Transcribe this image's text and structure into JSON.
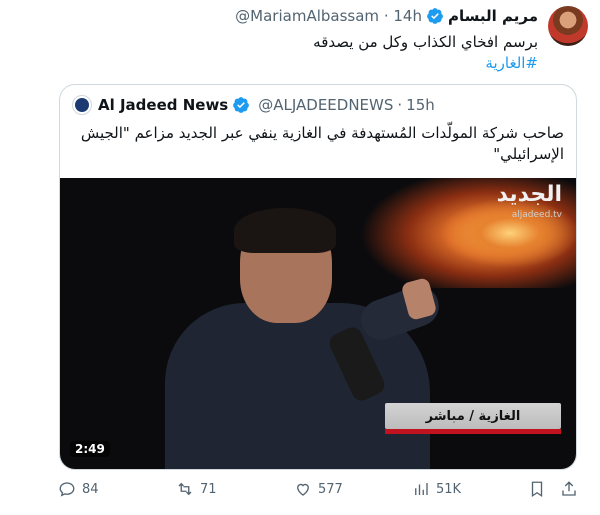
{
  "tweet": {
    "author_name": "مريم البسام",
    "handle": "@MariamAlbassam",
    "time": "14h",
    "separator": "·",
    "text": "برسم افخاي الكذاب وكل من يصدقه",
    "hashtag": "#الغارية",
    "more_label": "···",
    "verified_color": "#1d9bf0"
  },
  "quoted": {
    "name": "Al Jadeed News",
    "handle": "@ALJADEEDNEWS",
    "time": "15h",
    "separator": "·",
    "text": "صاحب شركة المولّدات المُستهدفة في الغازية ينفي عبر الجديد مزاعم \"الجيش الإسرائيلي\"",
    "video": {
      "logo_ar": "الجديد",
      "logo_url": "aljadeed.tv",
      "lower_third": "الغازية / مباشر",
      "duration": "2:49"
    }
  },
  "actions": {
    "reply_count": "84",
    "retweet_count": "71",
    "like_count": "577",
    "view_count": "51K"
  }
}
